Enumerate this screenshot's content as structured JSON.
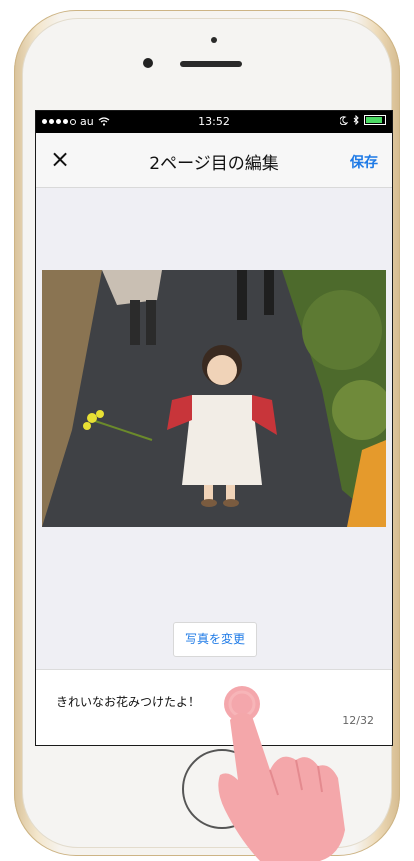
{
  "status_bar": {
    "carrier": "au",
    "time": "13:52"
  },
  "navbar": {
    "close_label": "×",
    "title": "2ページ目の編集",
    "save_label": "保存"
  },
  "photo_editor": {
    "change_photo_label": "写真を変更"
  },
  "caption": {
    "text": "きれいなお花みつけたよ！",
    "counter": "12/32"
  },
  "colors": {
    "accent": "#1e7ae6",
    "battery": "#4cd964"
  }
}
